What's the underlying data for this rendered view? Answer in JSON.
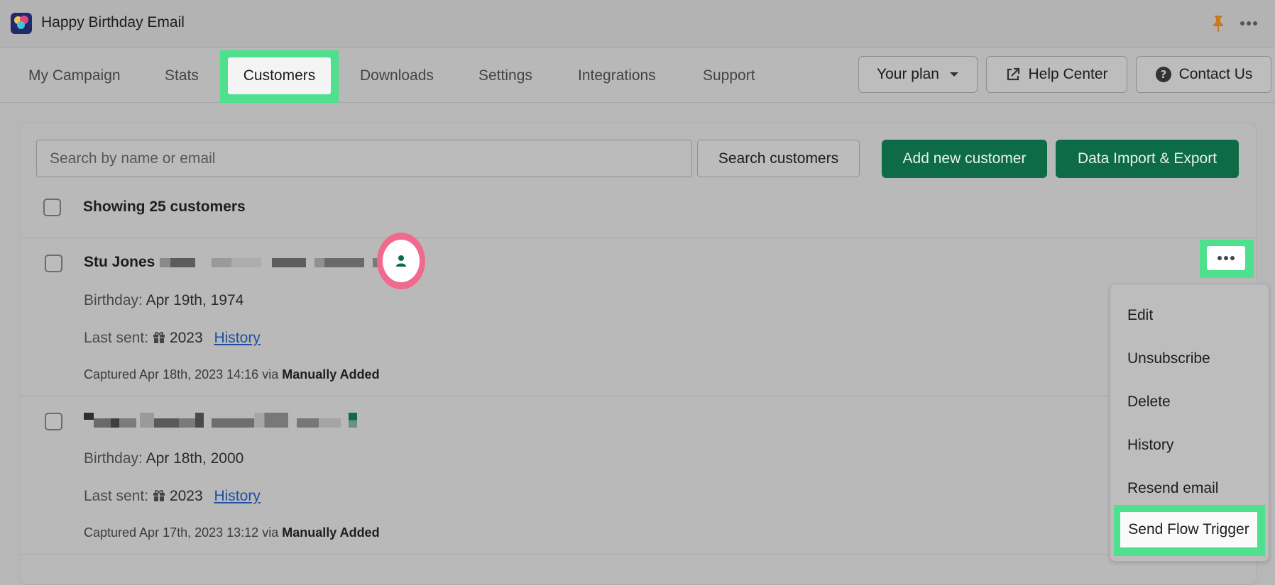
{
  "app": {
    "title": "Happy Birthday Email"
  },
  "nav": {
    "tabs": [
      {
        "label": "My Campaign"
      },
      {
        "label": "Stats"
      },
      {
        "label": "Customers"
      },
      {
        "label": "Downloads"
      },
      {
        "label": "Settings"
      },
      {
        "label": "Integrations"
      },
      {
        "label": "Support"
      }
    ],
    "active_tab": "Customers",
    "plan_label": "Your plan",
    "help_label": "Help Center",
    "contact_label": "Contact Us"
  },
  "toolbar": {
    "search_placeholder": "Search by name or email",
    "search_button": "Search customers",
    "add_button": "Add new customer",
    "import_button": "Data Import & Export"
  },
  "list": {
    "showing": "Showing 25 customers",
    "customers": [
      {
        "name": "Stu Jones",
        "birthday_label": "Birthday:",
        "birthday": "Apr 19th, 1974",
        "last_sent_label": "Last sent:",
        "last_sent": "2023",
        "history_link": "History",
        "captured": "Captured Apr 18th, 2023 14:16 via",
        "source": "Manually Added"
      },
      {
        "name": "",
        "birthday_label": "Birthday:",
        "birthday": "Apr 18th, 2000",
        "last_sent_label": "Last sent:",
        "last_sent": "2023",
        "history_link": "History",
        "captured": "Captured Apr 17th, 2023 13:12 via",
        "source": "Manually Added"
      }
    ]
  },
  "menu": {
    "items": [
      "Edit",
      "Unsubscribe",
      "Delete",
      "History",
      "Resend email",
      "Send Flow Trigger"
    ]
  },
  "colors": {
    "accent_green": "#0d6b47",
    "highlight_green": "#4ee08d",
    "highlight_pink": "#f06a8e",
    "link_blue": "#1f4fa0"
  }
}
